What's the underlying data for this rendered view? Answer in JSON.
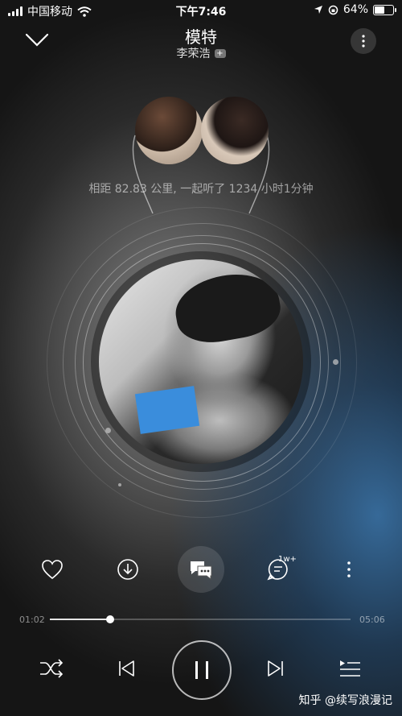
{
  "status_bar": {
    "carrier": "中国移动",
    "time": "下午7:46",
    "battery": "64%",
    "battery_level": 0.64
  },
  "header": {
    "title": "模特",
    "artist": "李荣浩",
    "plus": "+"
  },
  "together": "相距 82.83 公里, 一起听了 1234 小时1分钟",
  "actions": {
    "comments_badge": "1w+"
  },
  "progress": {
    "elapsed": "01:02",
    "duration": "05:06",
    "fraction": 0.2
  },
  "watermark": "知乎 @续写浪漫记",
  "colors": {
    "accent_blue": "#3a8ddc",
    "text_white": "#ffffff"
  }
}
